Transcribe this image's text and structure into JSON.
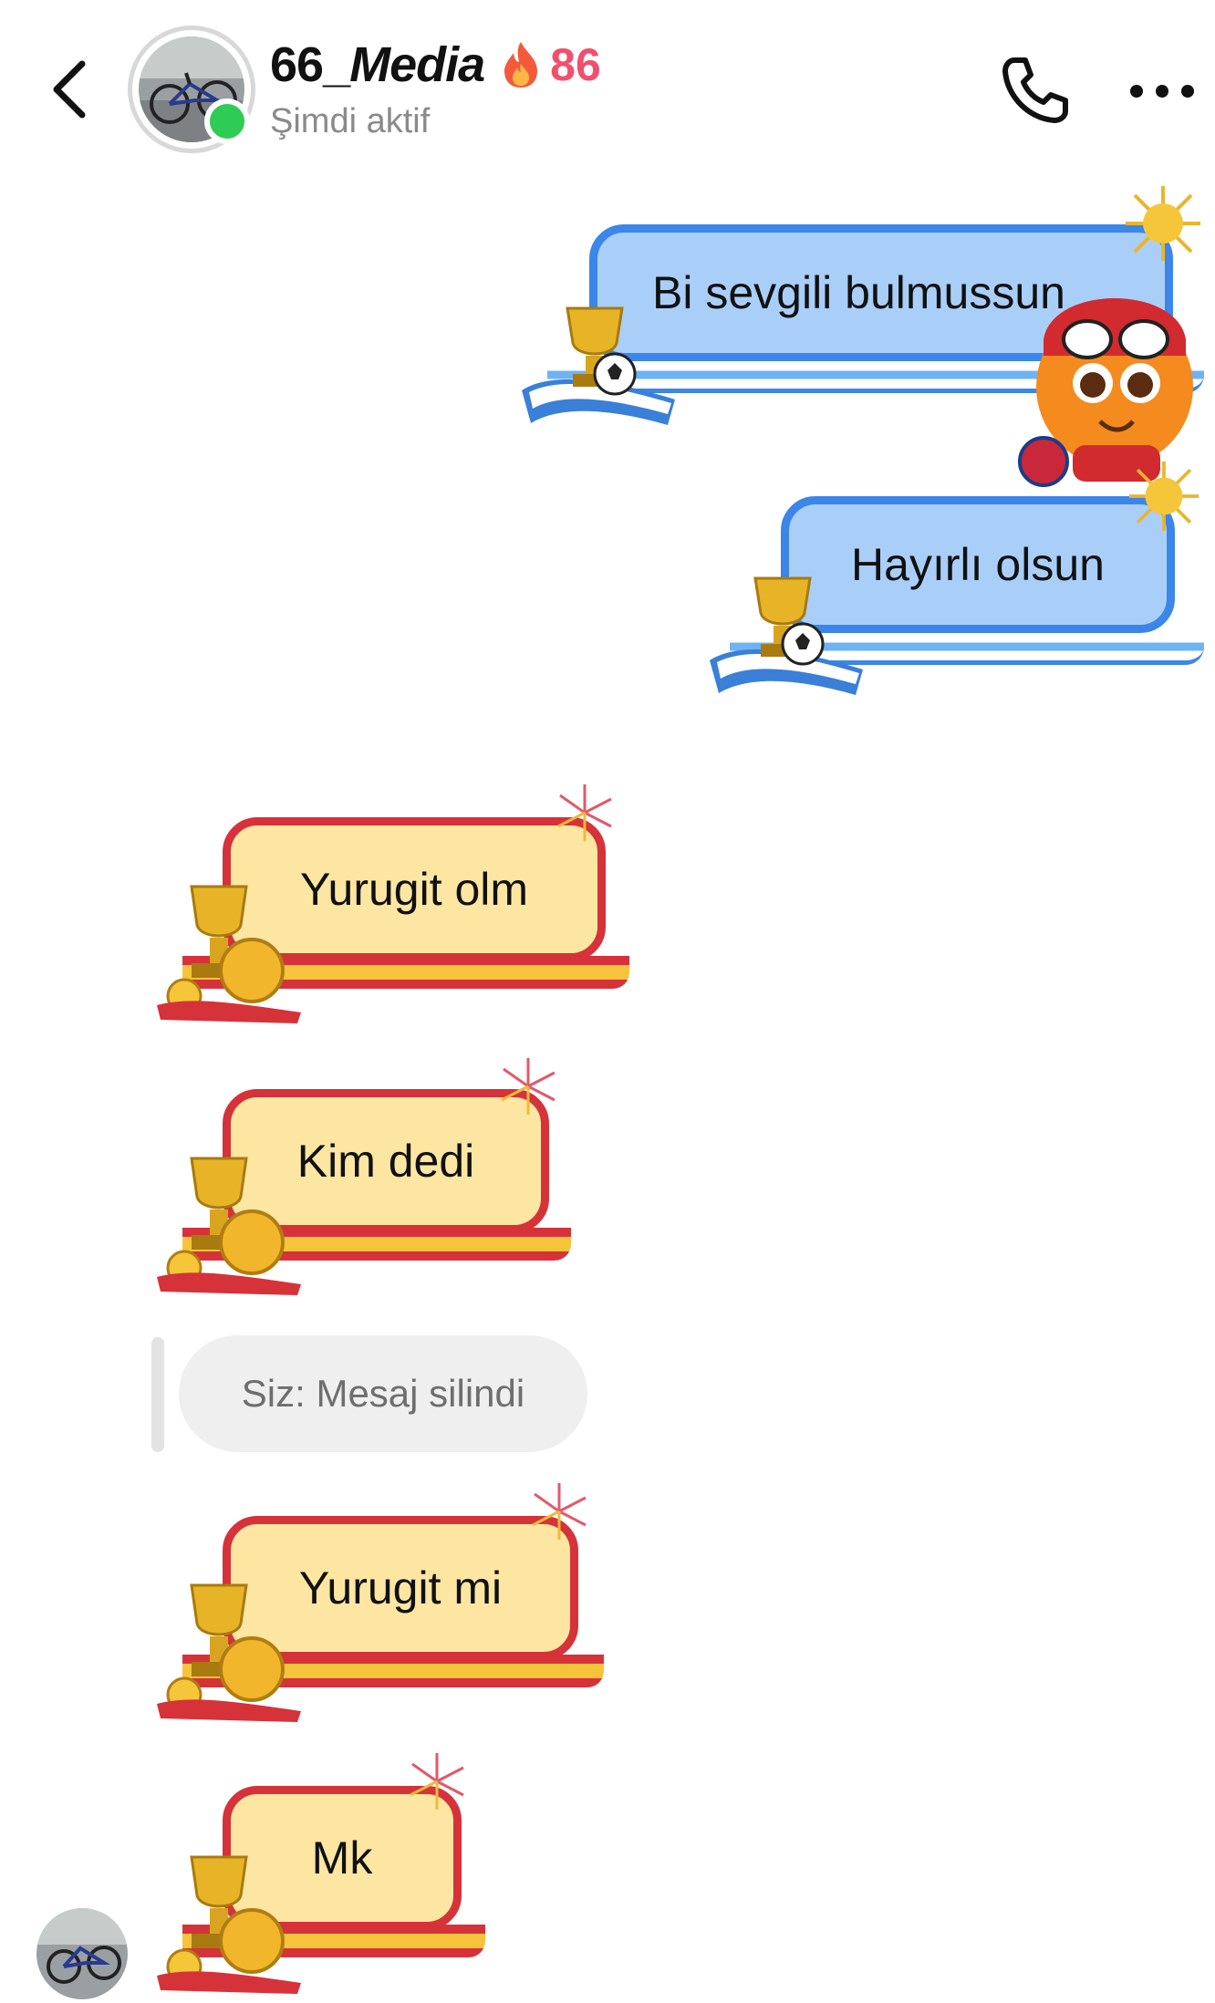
{
  "header": {
    "back_label": "Back",
    "name_prefix": "66_",
    "name_main": "Media",
    "streak_count": "86",
    "status": "Şimdi aktif",
    "icons": {
      "back": "chevron-left-icon",
      "call": "phone-icon",
      "more": "more-dots-icon",
      "streak": "fire-icon"
    }
  },
  "messages": [
    {
      "side": "sent",
      "text": "Bi sevgili bulmussun"
    },
    {
      "side": "sent",
      "text": "Hayırlı olsun"
    },
    {
      "side": "received",
      "text": "Yurugit olm"
    },
    {
      "side": "received",
      "text": "Kim dedi"
    },
    {
      "side": "deleted",
      "text": "Siz: Mesaj silindi"
    },
    {
      "side": "received",
      "text": "Yurugit mi"
    },
    {
      "side": "received",
      "text": "Mk"
    }
  ],
  "colors": {
    "sent_bubble": "#a9cff9",
    "sent_border": "#3b86e8",
    "received_bubble": "#fde6a2",
    "received_border": "#d6323a",
    "online": "#2ecc55",
    "streak": "#f0506e"
  }
}
